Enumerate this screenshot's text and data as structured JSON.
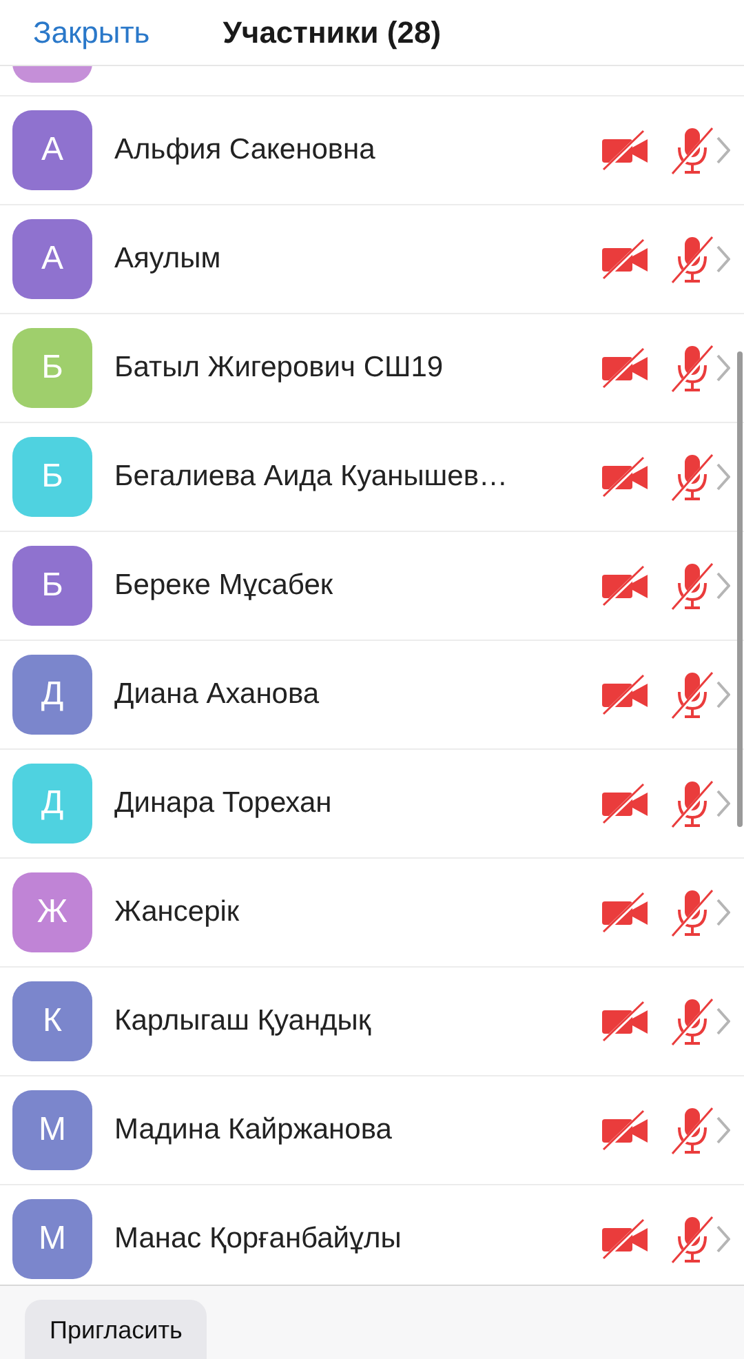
{
  "header": {
    "close": "Закрыть",
    "title": "Участники (28)"
  },
  "partial_avatar": {
    "color": "#c58fd8"
  },
  "participants": [
    {
      "initial": "А",
      "name": "Альфия Сакеновна",
      "color": "#8f72cf",
      "video_off": true,
      "muted": true
    },
    {
      "initial": "А",
      "name": "Аяулым",
      "color": "#8f72cf",
      "video_off": true,
      "muted": true
    },
    {
      "initial": "Б",
      "name": "Батыл Жигерович СШ19",
      "color": "#9fcf6c",
      "video_off": true,
      "muted": true
    },
    {
      "initial": "Б",
      "name": "Бегалиева Аида Куанышев…",
      "color": "#4fd2e0",
      "video_off": true,
      "muted": true
    },
    {
      "initial": "Б",
      "name": "Береке Мұсабек",
      "color": "#8f72cf",
      "video_off": true,
      "muted": true
    },
    {
      "initial": "Д",
      "name": "Диана Аханова",
      "color": "#7b86cc",
      "video_off": true,
      "muted": true
    },
    {
      "initial": "Д",
      "name": "Динара Торехан",
      "color": "#4fd2e0",
      "video_off": true,
      "muted": true
    },
    {
      "initial": "Ж",
      "name": "Жансерік",
      "color": "#c084d6",
      "video_off": true,
      "muted": true
    },
    {
      "initial": "К",
      "name": "Карлыгаш Қуандық",
      "color": "#7b86cc",
      "video_off": true,
      "muted": true
    },
    {
      "initial": "М",
      "name": "Мадина Кайржанова",
      "color": "#7b86cc",
      "video_off": true,
      "muted": true
    },
    {
      "initial": "М",
      "name": "Манас Қорғанбайұлы",
      "color": "#7b86cc",
      "video_off": true,
      "muted": true
    }
  ],
  "footer": {
    "invite": "Пригласить"
  }
}
